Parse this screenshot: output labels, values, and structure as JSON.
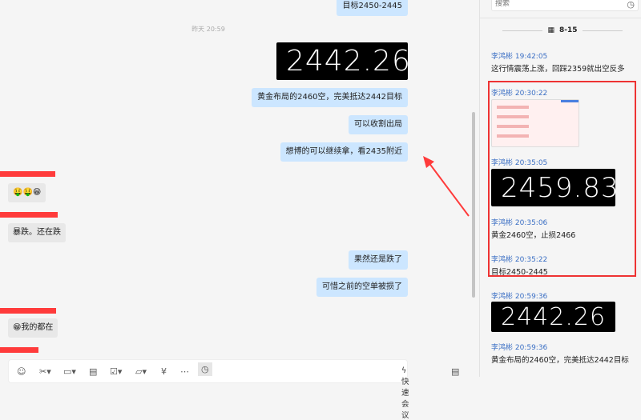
{
  "chat": {
    "messages": [
      {
        "side": "me",
        "text": "目标2450-2445"
      },
      {
        "type": "timestamp",
        "text": "昨天 20:59"
      },
      {
        "side": "me",
        "type": "image",
        "text": "2442.26"
      },
      {
        "side": "me",
        "text": "黄金布局的2460空，完美抵达2442目标"
      },
      {
        "side": "me",
        "text": "可以收割出局"
      },
      {
        "side": "me",
        "text": "想博的可以继续拿，看2435附近"
      },
      {
        "side": "other",
        "text": "🤑🤑😁"
      },
      {
        "side": "other",
        "text": "暴跌。还在跌"
      },
      {
        "side": "me",
        "text": "果然还是跌了"
      },
      {
        "side": "me",
        "text": "可惜之前的空单被损了"
      },
      {
        "side": "other",
        "text": "😁我的都在"
      }
    ],
    "annotation_color": "#ff3b3b"
  },
  "toolbar": {
    "quick_meeting": "快速会议",
    "icons": [
      "emoji-icon",
      "scissors-icon",
      "image-icon",
      "document-icon",
      "task-icon",
      "folder-icon",
      "red-packet-icon",
      "more-icon",
      "history-icon",
      "sidebar-icon"
    ]
  },
  "history": {
    "search_placeholder": "搜索",
    "date": "8-15",
    "entries": [
      {
        "meta": "李鸿彬 19:42:05",
        "text": "这行情震荡上涨，回踩2359就出空反多"
      },
      {
        "meta": "李鸿彬 20:30:22",
        "type": "screenshot"
      },
      {
        "meta": "李鸿彬 20:35:05",
        "image_text": "2459.83"
      },
      {
        "meta": "李鸿彬 20:35:06",
        "text": "黄金2460空，止损2466"
      },
      {
        "meta": "李鸿彬 20:35:22",
        "text": "目标2450-2445"
      },
      {
        "meta": "李鸿彬 20:59:36",
        "image_text": "2442.26"
      },
      {
        "meta": "李鸿彬 20:59:36",
        "text": "黄金布局的2460空，完美抵达2442目标"
      }
    ]
  }
}
